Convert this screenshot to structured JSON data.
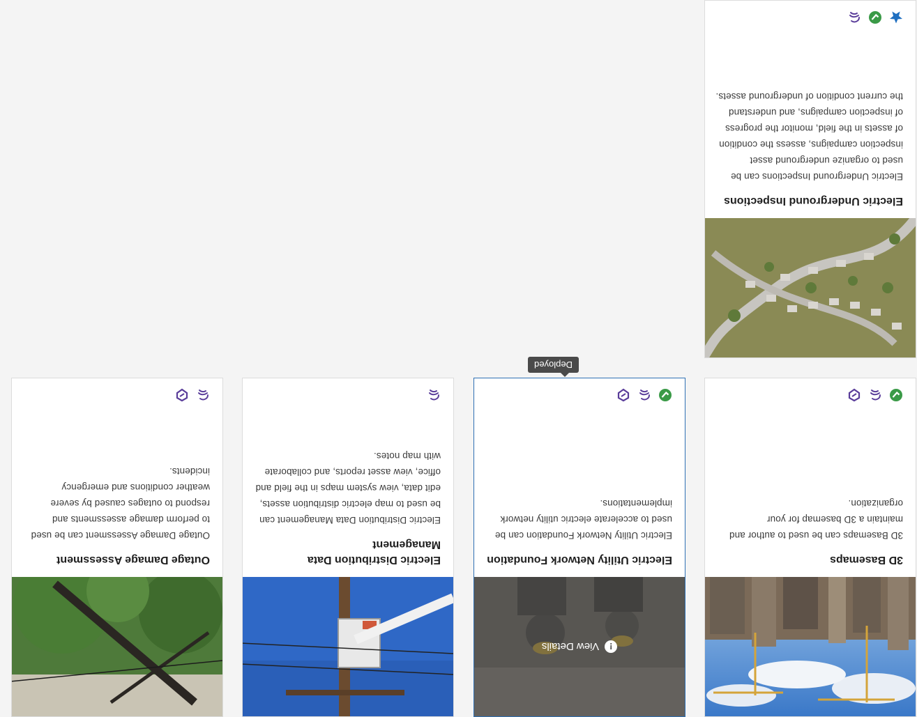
{
  "cards": [
    {
      "title": "3D Basemaps",
      "description": "3D Basemaps can be used to author and maintain a 3D basemap for your organization.",
      "icons": [
        "deployed-check-icon",
        "hand-stroke-icon",
        "shield-badge-icon"
      ]
    },
    {
      "title": "Electric Utility Network Foundation",
      "description": "Electric Utility Network Foundation can be used to accelerate electric utility network implementations.",
      "overlay_label": "View Details",
      "icons": [
        "deployed-check-icon",
        "hand-stroke-icon",
        "shield-badge-icon"
      ],
      "tooltip": "Deployed"
    },
    {
      "title": "Electric Distribution Data Management",
      "description": "Electric Distribution Data Management can be used to map electric distribution assets, edit data, view system maps in the field and office, view asset reports, and collaborate with map notes.",
      "icons": [
        "hand-stroke-icon"
      ]
    },
    {
      "title": "Outage Damage Assessment",
      "description": "Outage Damage Assessment can be used to perform damage assessments and respond to outages caused by severe weather conditions and emergency incidents.",
      "icons": [
        "hand-stroke-icon",
        "shield-badge-icon"
      ]
    },
    {
      "title": "Electric Underground Inspections",
      "description": "Electric Underground Inspections can be used to organize underground asset inspection campaigns, assess the condition of assets in the field, monitor the progress of inspection campaigns, and understand the current condition of underground assets.",
      "icons": [
        "favorite-star-icon",
        "deployed-check-icon",
        "hand-stroke-icon"
      ]
    }
  ],
  "colors": {
    "accent": "#2e6fb3",
    "deployed_green": "#3a9a47",
    "icon_purple": "#5a3d9a",
    "star_blue": "#1f6fc0"
  }
}
